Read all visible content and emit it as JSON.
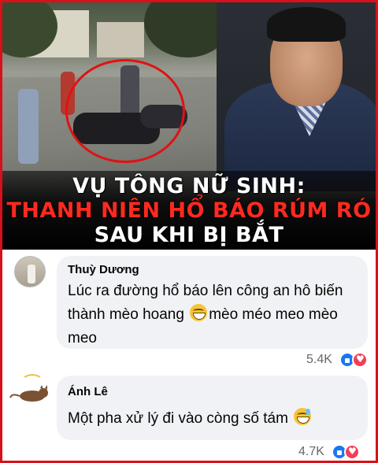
{
  "news": {
    "headline_line1": "VỤ TÔNG NỮ SINH:",
    "headline_line2": "THANH NIÊN HỔ BÁO RÚM RÓ",
    "headline_line3": "SAU KHI BỊ BẮT"
  },
  "comments": [
    {
      "author": "Thuỳ Dương",
      "text_before_emoji": "Lúc ra đường hổ báo lên công an hô biến thành mèo hoang ",
      "text_after_emoji": "mèo méo meo mèo meo",
      "reaction_count": "5.4K",
      "emoji": "grinning-face-icon"
    },
    {
      "author": "Ánh Lê",
      "text_before_emoji": "Một pha xử lý đi vào còng số tám ",
      "text_after_emoji": "",
      "reaction_count": "4.7K",
      "emoji": "grinning-sweat-face-icon"
    }
  ],
  "colors": {
    "frame_border": "#d8101a",
    "headline_red": "#ff2a1f",
    "bubble_bg": "#f0f2f5",
    "like_blue": "#1877f2",
    "love_red": "#f33e58"
  }
}
